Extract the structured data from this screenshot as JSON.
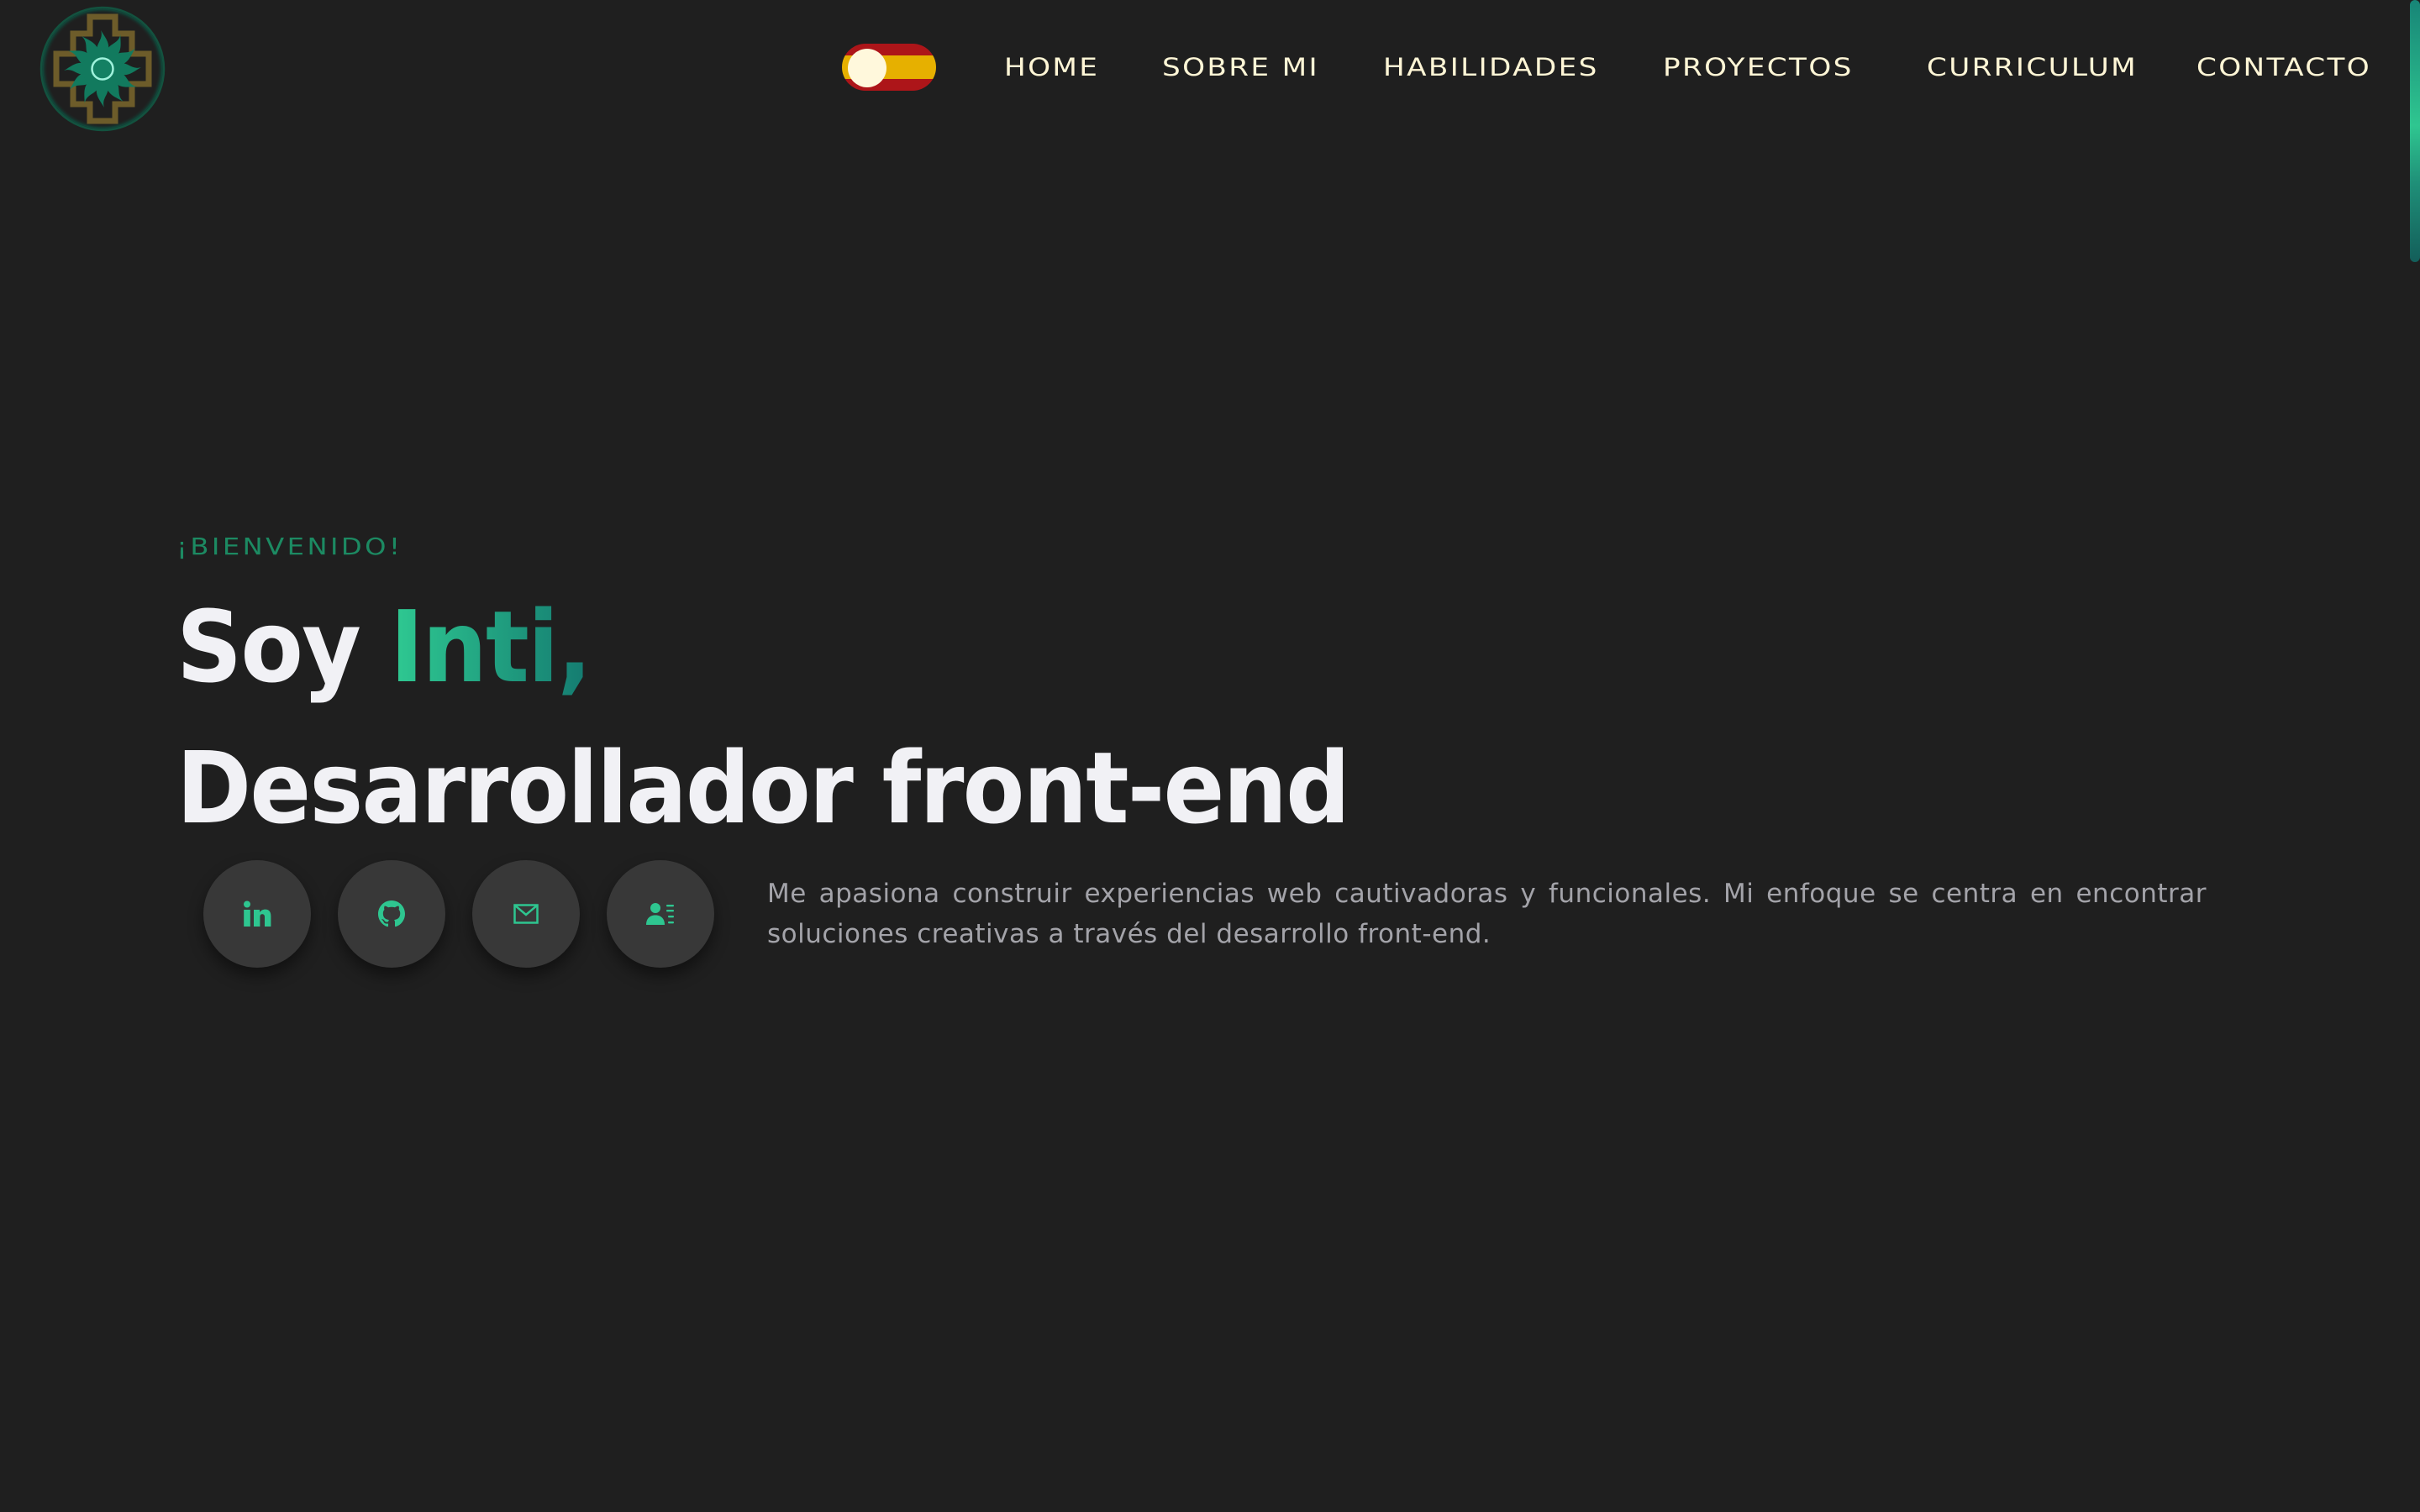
{
  "header": {
    "logo_alt": "Chakana sun logo",
    "language_toggle": {
      "state": "es",
      "label": "Spanish flag language toggle",
      "colors": {
        "red": "#ad1519",
        "yellow": "#e6b000",
        "knob": "#fff8dc"
      }
    },
    "nav": [
      {
        "label": "HOME"
      },
      {
        "label": "SOBRE MI"
      },
      {
        "label": "HABILIDADES"
      },
      {
        "label": "PROYECTOS"
      },
      {
        "label": "CURRICULUM"
      },
      {
        "label": "CONTACTO"
      }
    ]
  },
  "hero": {
    "welcome": "¡BIENVENIDO!",
    "greeting": "Soy",
    "name": "Inti,",
    "role": "Desarrollador front-end",
    "description": "Me apasiona construir experiencias web cautivadoras y funcionales. Mi enfoque se centra en encontrar soluciones creativas a través del desarrollo front-end.",
    "socials": [
      {
        "icon": "linkedin-icon",
        "label": "LinkedIn"
      },
      {
        "icon": "github-icon",
        "label": "GitHub"
      },
      {
        "icon": "mail-icon",
        "label": "Email"
      },
      {
        "icon": "contact-card-icon",
        "label": "Curriculum"
      }
    ]
  },
  "colors": {
    "background": "#1f1f1f",
    "accent": "#2ec690",
    "accent_dark": "#147a70",
    "welcome": "#1c8a62",
    "nav_text": "#fff6d6",
    "heading": "#f1f1f5",
    "body_text": "#a3a3a9",
    "button_bg": "#383838"
  }
}
